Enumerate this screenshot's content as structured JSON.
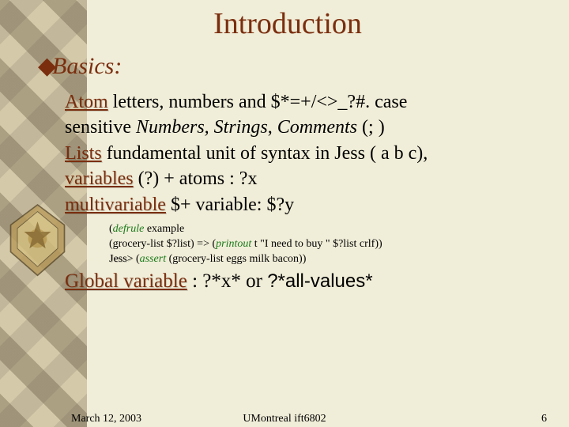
{
  "title": "Introduction",
  "bullet_glyph": "◆",
  "subhead": "Basics:",
  "terms": {
    "atom": "Atom",
    "lists": "Lists",
    "variables": "variables",
    "multivariable": "multivariable",
    "global_variable": "Global variable"
  },
  "body": {
    "atom_rest": " letters, numbers and $*=+/<>_?#.  case",
    "atom_line2a": "sensitive ",
    "atom_line2b": "Numbers, Strings",
    "atom_line2c": ", ",
    "atom_line2d": "Comments",
    "atom_line2e": " (; )",
    "lists_rest": " fundamental unit of syntax in Jess ( a b c),",
    "variables_rest": " (?) + atoms : ?x",
    "multivariable_rest": " $+ variable:  $?y"
  },
  "code": {
    "l1a": "(",
    "kw_defrule": "defrule",
    "l1b": " example",
    "l2a": "(grocery-list $?list) => (",
    "kw_printout": "printout",
    "l2b": " t \"I need to buy \" $?list crlf))",
    "jess_prompt": "Jess>",
    "l3a": " (",
    "kw_assert": "assert",
    "l3b": " (grocery-list eggs milk bacon))"
  },
  "gv_rest": " : ?*x* or ",
  "gv_all": "?*all-values*",
  "footer": {
    "date": "March 12, 2003",
    "center": "UMontreal ift6802",
    "page": "6"
  }
}
